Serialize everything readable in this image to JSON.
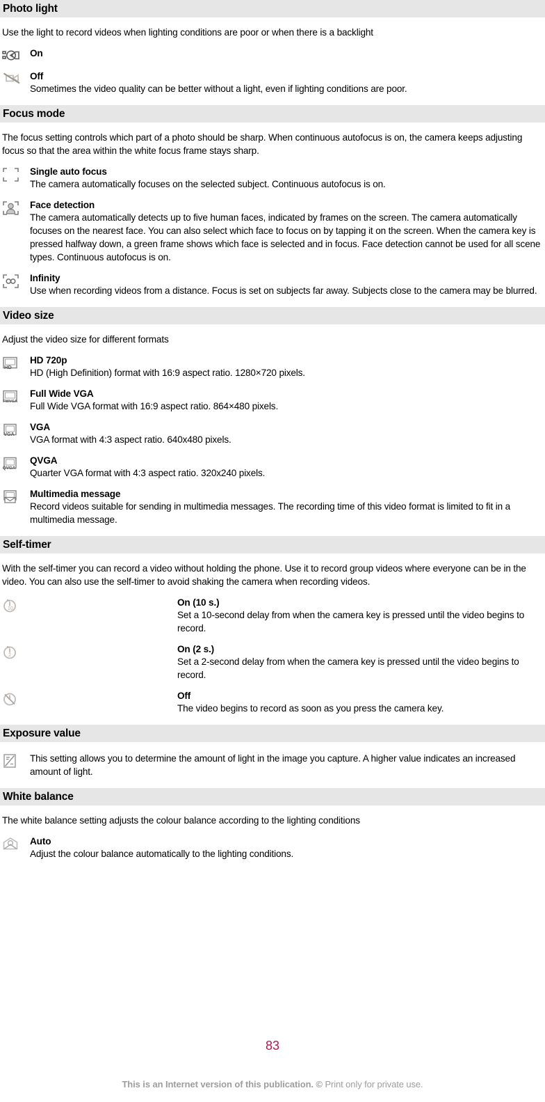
{
  "sections": [
    {
      "title": "Photo light",
      "intro": "Use the light to record videos when lighting conditions are poor or when there is a backlight",
      "options": [
        {
          "icon": "photo-light-on-icon",
          "title": "On",
          "desc": ""
        },
        {
          "icon": "photo-light-off-icon",
          "title": "Off",
          "desc": "Sometimes the video quality can be better without a light, even if lighting conditions are poor."
        }
      ]
    },
    {
      "title": "Focus mode",
      "intro": "The focus setting controls which part of a photo should be sharp. When continuous autofocus is on, the camera keeps adjusting focus so that the area within the white focus frame stays sharp.",
      "options": [
        {
          "icon": "single-auto-focus-icon",
          "title": "Single auto focus",
          "desc": "The camera automatically focuses on the selected subject. Continuous autofocus is on."
        },
        {
          "icon": "face-detection-icon",
          "title": "Face detection",
          "desc": "The camera automatically detects up to five human faces, indicated by frames on the screen. The camera automatically focuses on the nearest face. You can also select which face to focus on by tapping it on the screen. When the camera key is pressed halfway down, a green frame shows which face is selected and in focus. Face detection cannot be used for all scene types. Continuous autofocus is on."
        },
        {
          "icon": "infinity-focus-icon",
          "title": "Infinity",
          "desc": "Use when recording videos from a distance. Focus is set on subjects far away. Subjects close to the camera may be blurred."
        }
      ]
    },
    {
      "title": "Video size",
      "intro": "Adjust the video size for different formats",
      "options": [
        {
          "icon": "hd-720p-icon",
          "icon_label": "HD",
          "title": "HD 720p",
          "desc": "HD (High Definition) format with 16:9 aspect ratio. 1280×720 pixels."
        },
        {
          "icon": "full-wide-vga-icon",
          "icon_label": "FWVGA",
          "title": "Full Wide VGA",
          "desc": "Full Wide VGA format with 16:9 aspect ratio. 864×480 pixels."
        },
        {
          "icon": "vga-icon",
          "icon_label": "VGA",
          "title": "VGA",
          "desc": "VGA format with 4:3 aspect ratio. 640x480 pixels."
        },
        {
          "icon": "qvga-icon",
          "icon_label": "QVGA",
          "title": "QVGA",
          "desc": "Quarter VGA format with 4:3 aspect ratio. 320x240 pixels."
        },
        {
          "icon": "multimedia-message-icon",
          "title": "Multimedia message",
          "desc": "Record videos suitable for sending in multimedia messages. The recording time of this video format is limited to fit in a multimedia message."
        }
      ]
    },
    {
      "title": "Self-timer",
      "intro": "With the self-timer you can record a video without holding the phone. Use it to record group videos where everyone can be in the video. You can also use the self-timer to avoid shaking the camera when recording videos.",
      "indented": true,
      "options": [
        {
          "icon": "self-timer-10s-icon",
          "title": "On (10 s.)",
          "desc": "Set a 10-second delay from when the camera key is pressed until the video begins to record."
        },
        {
          "icon": "self-timer-2s-icon",
          "title": "On (2 s.)",
          "desc": "Set a 2-second delay from when the camera key is pressed until the video begins to record."
        },
        {
          "icon": "self-timer-off-icon",
          "title": "Off",
          "desc": "The video begins to record as soon as you press the camera key."
        }
      ]
    },
    {
      "title": "Exposure value",
      "intro": "",
      "options": [
        {
          "icon": "exposure-value-icon",
          "title": "",
          "desc": "This setting allows you to determine the amount of light in the image you capture. A higher value indicates an increased amount of light."
        }
      ]
    },
    {
      "title": "White balance",
      "intro": "The white balance setting adjusts the colour balance according to the lighting conditions",
      "options": [
        {
          "icon": "white-balance-auto-icon",
          "title": "Auto",
          "desc": "Adjust the colour balance automatically to the lighting conditions."
        }
      ]
    }
  ],
  "page_number": "83",
  "footer": {
    "bold_part": "This is an Internet version of this publication. © ",
    "rest": "Print only for private use."
  },
  "colors": {
    "header_band": "#e6e6e6",
    "page_number": "#b5174e",
    "footer_text": "#9d9d9d"
  }
}
